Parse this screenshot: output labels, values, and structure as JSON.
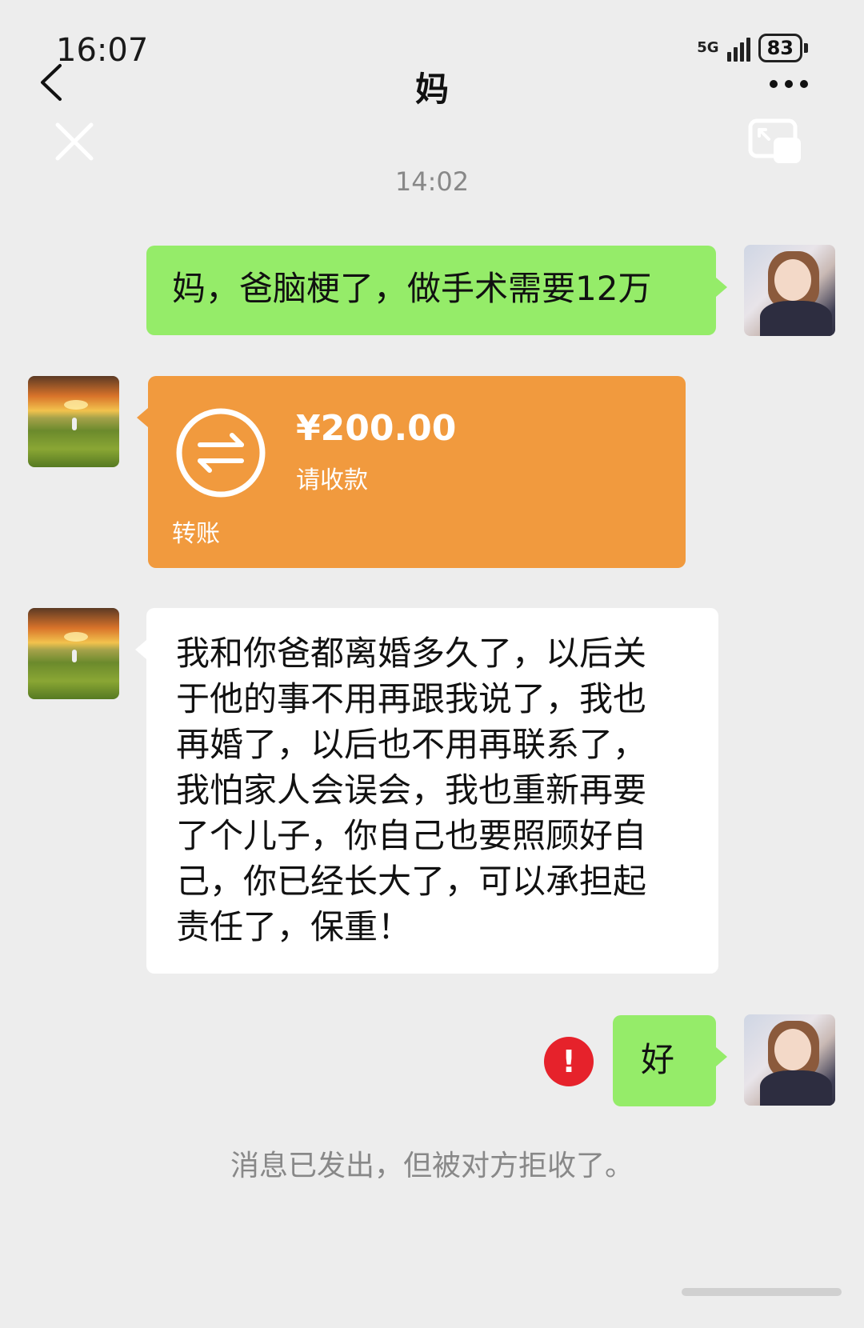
{
  "status_bar": {
    "time": "16:07",
    "network": "5G",
    "battery": "83"
  },
  "nav": {
    "title": "妈",
    "back_icon": "chevron-left-icon",
    "close_icon": "close-icon",
    "more_icon": "more-dots-icon",
    "float_icon": "floating-window-icon"
  },
  "chat": {
    "timestamp": "14:02",
    "messages": [
      {
        "sender": "me",
        "type": "text",
        "text": "妈，爸脑梗了，做手术需要12万"
      },
      {
        "sender": "mom",
        "type": "transfer",
        "amount": "¥200.00",
        "status": "请收款",
        "label": "转账"
      },
      {
        "sender": "mom",
        "type": "text",
        "lines": [
          "我和你爸都离婚多久了，以后关",
          "于他的事不用再跟我说了，我也",
          "再婚了，以后也不用再联系了，",
          "我怕家人会误会，我也重新再要",
          "了个儿子，你自己也要照顾好自",
          "己，你已经长大了，可以承担起",
          "责任了，保重！"
        ]
      },
      {
        "sender": "me",
        "type": "text",
        "text": "好",
        "failed": true,
        "error_icon": "!"
      }
    ],
    "system_note": "消息已发出，但被对方拒收了。"
  },
  "colors": {
    "background": "#ededed",
    "my_bubble": "#95ec69",
    "their_bubble": "#ffffff",
    "transfer": "#f19a3e",
    "error": "#e6222b"
  }
}
